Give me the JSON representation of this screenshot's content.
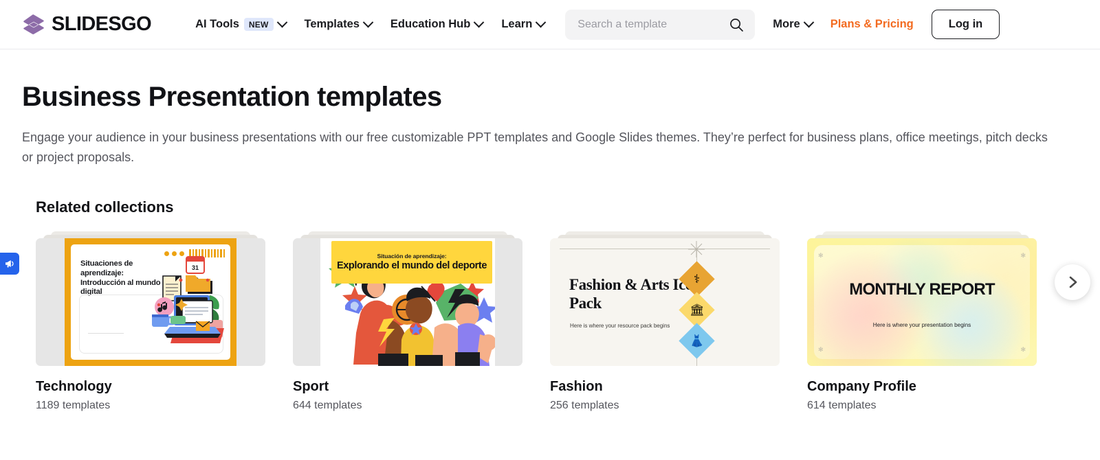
{
  "header": {
    "brand": {
      "name": "SLIDESGO",
      "logo_icon": "slidesgo-logo-icon",
      "logo_color": "#8d6ca8"
    },
    "nav": [
      {
        "label": "AI Tools",
        "badge": "NEW",
        "has_dropdown": true
      },
      {
        "label": "Templates",
        "badge": "",
        "has_dropdown": true
      },
      {
        "label": "Education Hub",
        "badge": "",
        "has_dropdown": true
      },
      {
        "label": "Learn",
        "badge": "",
        "has_dropdown": true
      }
    ],
    "search": {
      "placeholder": "Search a template",
      "value": "",
      "icon": "search-icon"
    },
    "more": {
      "label": "More",
      "has_dropdown": true
    },
    "pricing": {
      "label": "Plans & Pricing",
      "color": "#f36b20"
    },
    "login": {
      "label": "Log in"
    }
  },
  "main": {
    "title": "Business Presentation templates",
    "description": "Engage your audience in your business presentations with our free customizable PPT templates and Google Slides themes. They’re perfect for business plans, office meetings, pitch decks or project proposals."
  },
  "collections": {
    "title": "Related collections",
    "next_button_icon": "chevron-right-icon",
    "cards": [
      {
        "title": "Technology",
        "count": "1189 templates",
        "thumb": {
          "kind": "technology",
          "frame_color": "#eda312",
          "heading": "Situaciones de aprendizaje: Introducción al mundo digital"
        }
      },
      {
        "title": "Sport",
        "count": "644 templates",
        "thumb": {
          "kind": "sport",
          "banner_color": "#ffd63d",
          "kicker": "Situación de aprendizaje:",
          "heading": "Explorando el mundo del deporte"
        }
      },
      {
        "title": "Fashion",
        "count": "256 templates",
        "thumb": {
          "kind": "fashion",
          "background": "#f7f5f0",
          "heading": "Fashion & Arts Icon Pack",
          "subtitle": "Here is where your resource pack begins",
          "icons": [
            {
              "name": "snake-rod-icon",
              "glyph": "⚕",
              "color": "#e8a433"
            },
            {
              "name": "statue-icon",
              "glyph": "🏛",
              "color": "#fbd96b"
            },
            {
              "name": "dress-icon",
              "glyph": "👗",
              "color": "#7ec8ee"
            }
          ]
        }
      },
      {
        "title": "Company Profile",
        "count": "614 templates",
        "thumb": {
          "kind": "company-profile",
          "heading": "MONTHLY REPORT",
          "subtitle": "Here is where your presentation begins"
        }
      }
    ]
  },
  "widgets": {
    "feedback_tab": {
      "icon": "megaphone-icon",
      "color": "#2563eb"
    }
  }
}
